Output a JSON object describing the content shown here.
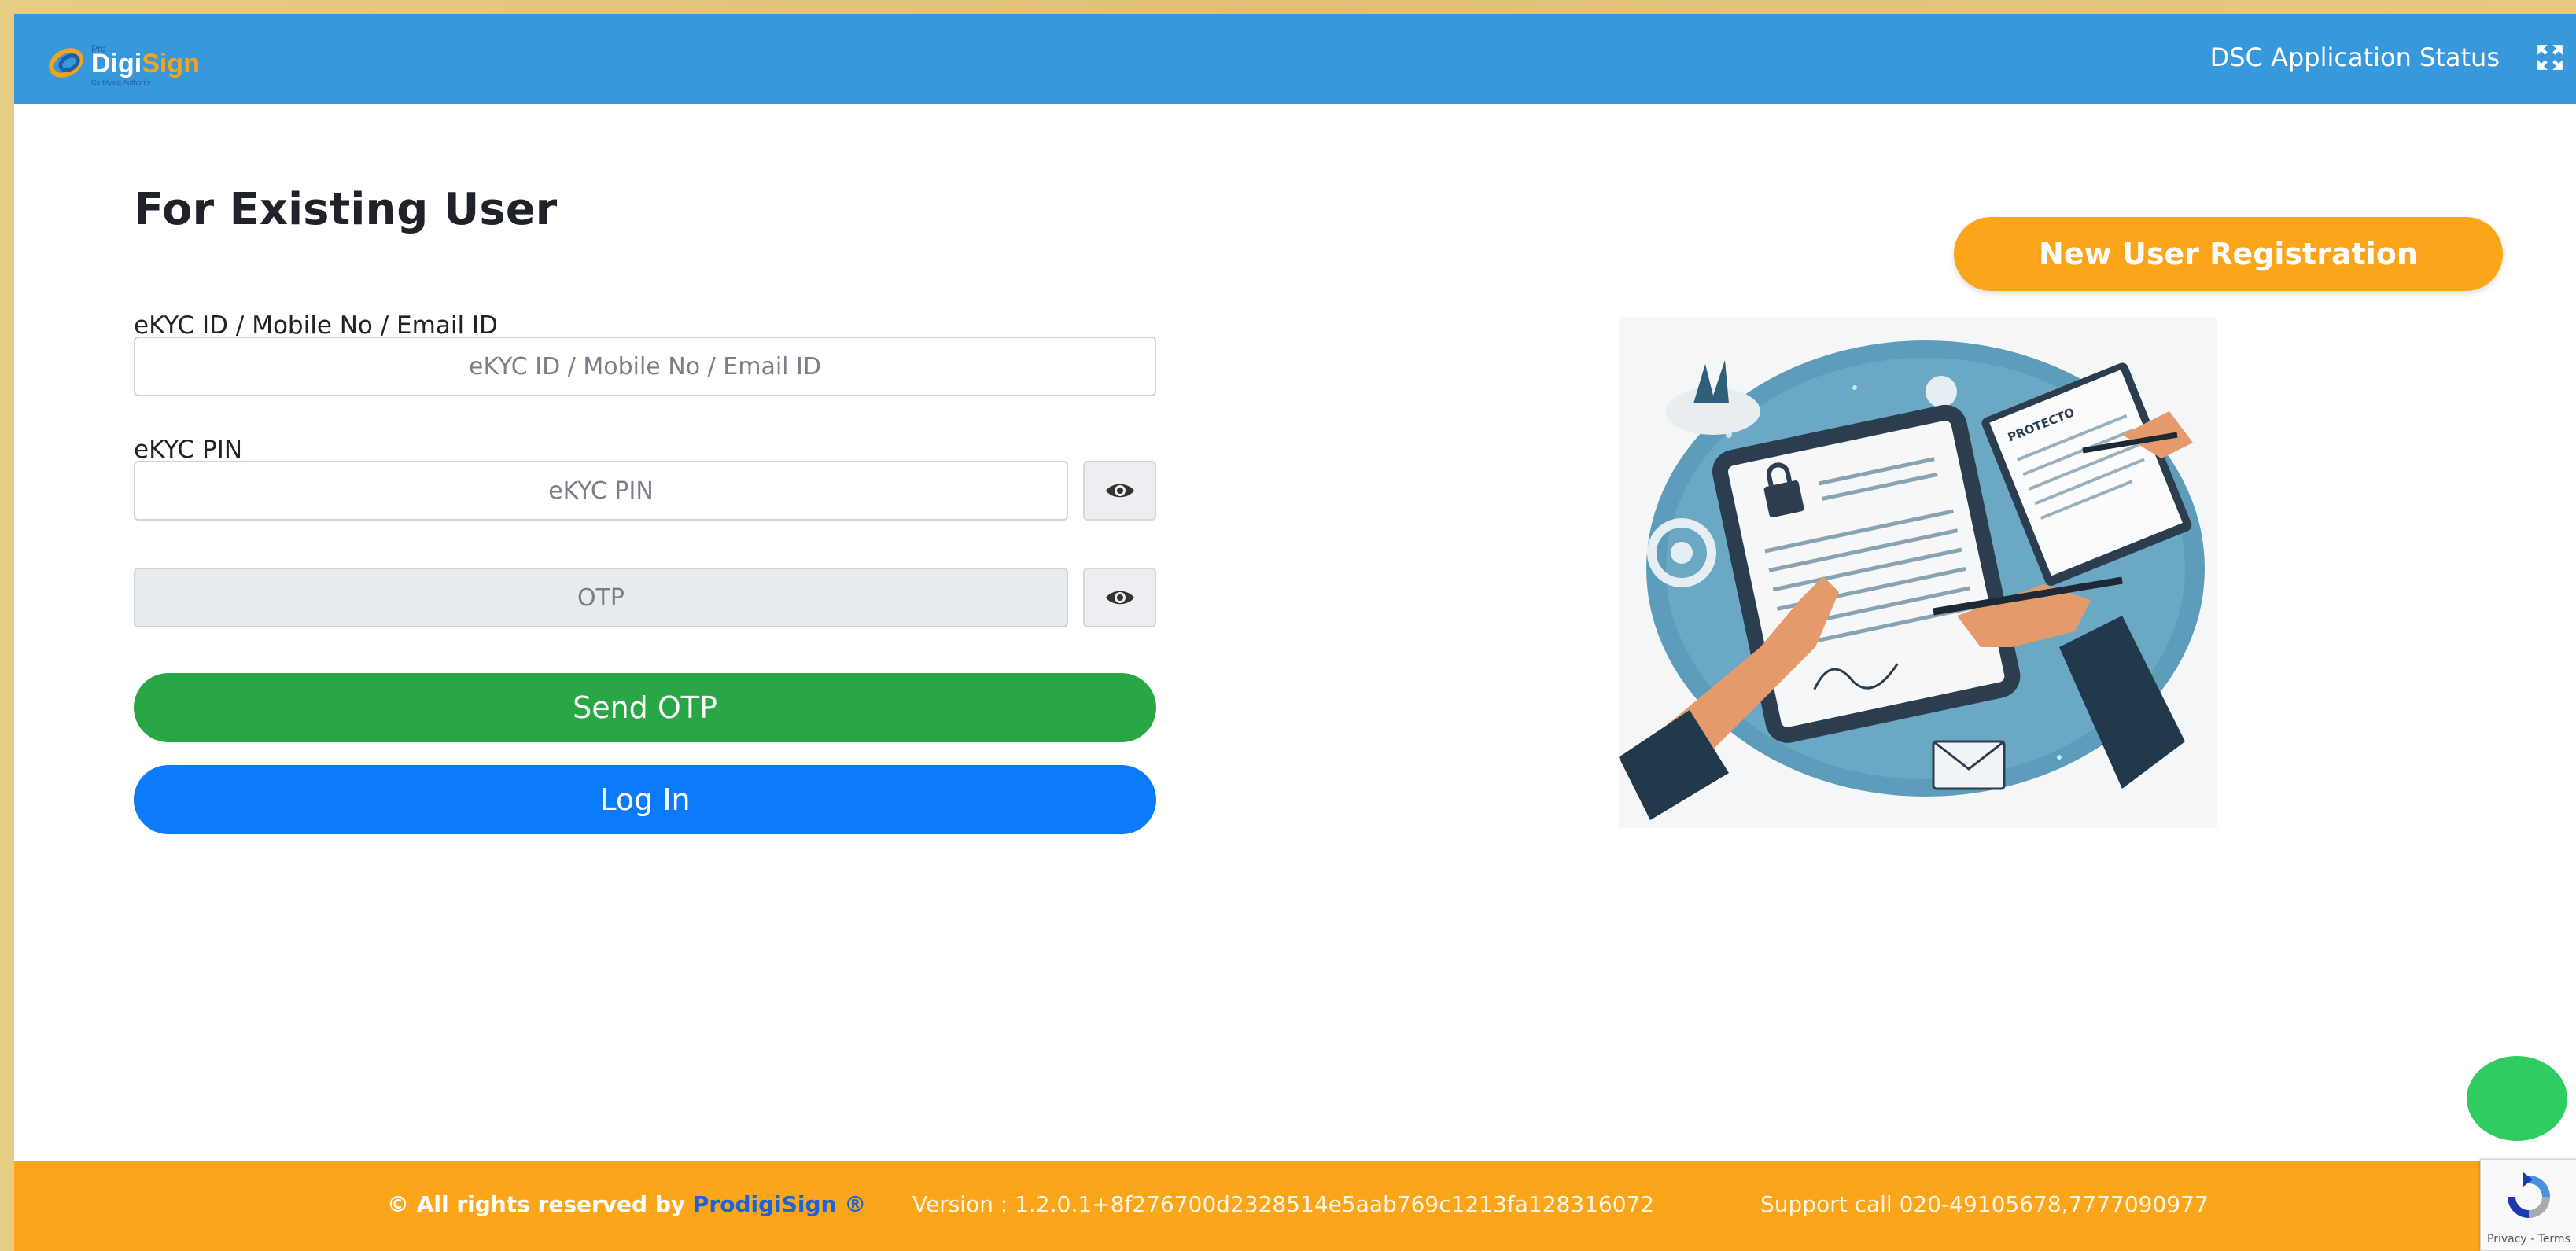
{
  "header": {
    "logo_text": "DigiSign",
    "logo_tagline": "Certifying Authority",
    "status_link": "DSC Application Status"
  },
  "form": {
    "title": "For Existing User",
    "id_label": "eKYC ID / Mobile No / Email ID",
    "id_placeholder": "eKYC ID / Mobile No / Email ID",
    "pin_label": "eKYC PIN",
    "pin_placeholder": "eKYC PIN",
    "otp_placeholder": "OTP",
    "send_otp": "Send OTP",
    "login": "Log In"
  },
  "right": {
    "new_user": "New User Registration",
    "illustration_caption": "PROTECTO"
  },
  "footer": {
    "copyright": "© All rights reserved by ",
    "brand": "ProdigiSign ®",
    "version": "Version : 1.2.0.1+8f276700d2328514e5aab769c1213fa128316072",
    "support": "Support call 020-49105678,7777090977"
  },
  "recaptcha": {
    "text": "Privacy - Terms"
  },
  "colors": {
    "header": "#3898dc",
    "footer": "#fba51a",
    "send_otp": "#29a744",
    "login": "#0b7bfc",
    "chat": "#2fcc62"
  }
}
